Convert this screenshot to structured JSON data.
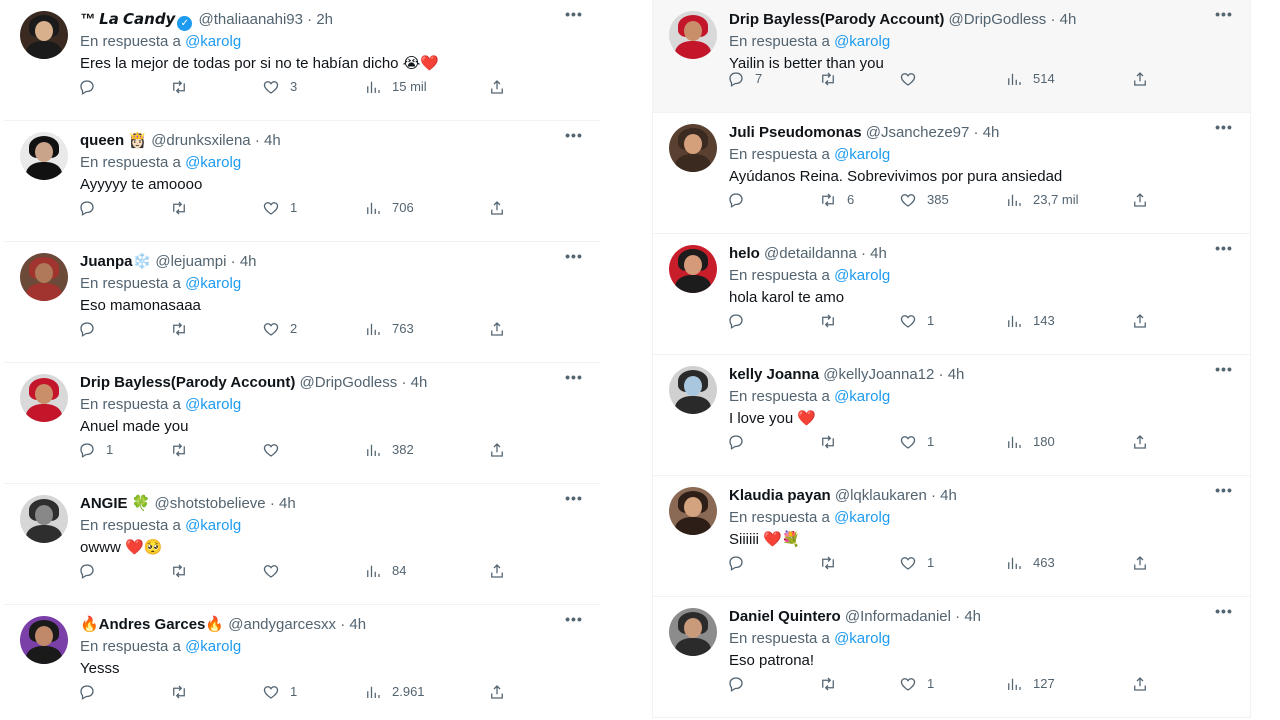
{
  "left_column": [
    {
      "name": "™ 𝙇𝙖 𝘾𝙖𝙣𝙙𝙮",
      "italic": true,
      "verified": true,
      "handle": "@thaliaanahi93",
      "time": "2h",
      "reply_prefix": "En respuesta a",
      "reply_to": "@karolg",
      "text": "Eres la mejor de todas por si no te habían dicho 😭❤️",
      "replies": "",
      "retweets": "",
      "likes": "3",
      "views": "15 mil",
      "avatar_colors": [
        "#3a2a22",
        "#d9b08c",
        "#1b1b1b"
      ]
    },
    {
      "name": "queen 👸🏻",
      "handle": "@drunksxilena",
      "time": "4h",
      "reply_prefix": "En respuesta a",
      "reply_to": "@karolg",
      "text": "Ayyyyy te amoooo",
      "replies": "",
      "retweets": "",
      "likes": "1",
      "views": "706",
      "avatar_colors": [
        "#e9e9e9",
        "#c9a48a",
        "#111111"
      ]
    },
    {
      "name": "Juanpa❄️",
      "handle": "@lejuampi",
      "time": "4h",
      "reply_prefix": "En respuesta a",
      "reply_to": "@karolg",
      "text": "Eso mamonasaaa",
      "replies": "",
      "retweets": "",
      "likes": "2",
      "views": "763",
      "avatar_colors": [
        "#6b4a3a",
        "#b07a5a",
        "#a1342f"
      ]
    },
    {
      "name": "Drip Bayless(Parody Account)",
      "handle": "@DripGodless",
      "time": "4h",
      "reply_prefix": "En respuesta a",
      "reply_to": "@karolg",
      "text": "Anuel made you",
      "replies": "1",
      "retweets": "",
      "likes": "",
      "views": "382",
      "avatar_colors": [
        "#d9d9d9",
        "#c98f6a",
        "#c4162a"
      ]
    },
    {
      "name": "ANGIE 🍀",
      "handle": "@shotstobelieve",
      "time": "4h",
      "reply_prefix": "En respuesta a",
      "reply_to": "@karolg",
      "text": "owww ❤️🥺",
      "replies": "",
      "retweets": "",
      "likes": "",
      "views": "84",
      "avatar_colors": [
        "#d6d6d6",
        "#888888",
        "#2e2e2e"
      ]
    },
    {
      "name": "🔥Andres Garces🔥",
      "handle": "@andygarcesxx",
      "time": "4h",
      "reply_prefix": "En respuesta a",
      "reply_to": "@karolg",
      "text": "Yesss",
      "replies": "",
      "retweets": "",
      "likes": "1",
      "views": "2.961",
      "avatar_colors": [
        "#7b3fa8",
        "#c08a6a",
        "#1a1a1a"
      ]
    }
  ],
  "right_column": [
    {
      "name": "Drip Bayless(Parody Account)",
      "handle": "@DripGodless",
      "time": "4h",
      "reply_prefix": "En respuesta a",
      "reply_to": "@karolg",
      "text": "Yailin is better than you",
      "replies": "7",
      "retweets": "",
      "likes": "",
      "views": "514",
      "highlight": true,
      "avatar_colors": [
        "#d9d9d9",
        "#c98f6a",
        "#c4162a"
      ]
    },
    {
      "name": "Juli Pseudomonas",
      "handle": "@Jsancheze97",
      "time": "4h",
      "reply_prefix": "En respuesta a",
      "reply_to": "@karolg",
      "text": "Ayúdanos Reina. Sobrevivimos por pura ansiedad",
      "replies": "",
      "retweets": "6",
      "likes": "385",
      "views": "23,7 mil",
      "avatar_colors": [
        "#5a4030",
        "#d4a07c",
        "#3a2a20"
      ]
    },
    {
      "name": "helo",
      "handle": "@detaildanna",
      "time": "4h",
      "reply_prefix": "En respuesta a",
      "reply_to": "@karolg",
      "text": "hola karol te amo",
      "replies": "",
      "retweets": "",
      "likes": "1",
      "views": "143",
      "avatar_colors": [
        "#c81e2c",
        "#d59a7a",
        "#1c1c1c"
      ]
    },
    {
      "name": "kelly Joanna",
      "handle": "@kellyJoanna12",
      "time": "4h",
      "reply_prefix": "En respuesta a",
      "reply_to": "@karolg",
      "text": "I love you ❤️",
      "replies": "",
      "retweets": "",
      "likes": "1",
      "views": "180",
      "avatar_colors": [
        "#d0d0d0",
        "#a9c8e0",
        "#2a2a2a"
      ]
    },
    {
      "name": "Klaudia payan",
      "handle": "@lqklaukaren",
      "time": "4h",
      "reply_prefix": "En respuesta a",
      "reply_to": "@karolg",
      "text": "Siiiiii ❤️💐",
      "replies": "",
      "retweets": "",
      "likes": "1",
      "views": "463",
      "avatar_colors": [
        "#8a6a55",
        "#d3a27e",
        "#2d1f18"
      ]
    },
    {
      "name": "Daniel Quintero",
      "handle": "@Informadaniel",
      "time": "4h",
      "reply_prefix": "En respuesta a",
      "reply_to": "@karolg",
      "text": "Eso patrona!",
      "replies": "",
      "retweets": "",
      "likes": "1",
      "views": "127",
      "avatar_colors": [
        "#8c8c8c",
        "#c99b7a",
        "#2b2b2b"
      ]
    }
  ],
  "icons": {
    "reply": "reply-icon",
    "retweet": "retweet-icon",
    "like": "heart-icon",
    "views": "views-icon",
    "share": "share-icon",
    "more": "more-icon"
  },
  "colors": {
    "accent": "#1d9bf0",
    "secondary_text": "#536471",
    "divider": "#eff3f4",
    "highlight_bg": "#f7f7f7"
  }
}
